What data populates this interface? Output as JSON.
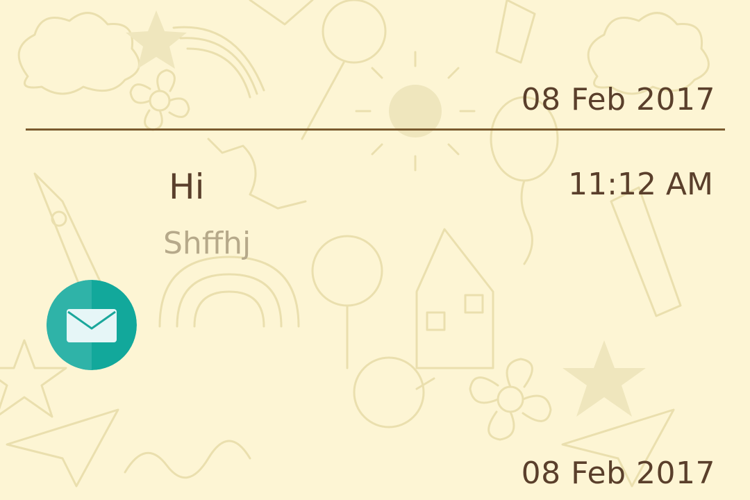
{
  "header_date_top": "08 Feb 2017",
  "header_date_bottom": "08 Feb 2017",
  "message": {
    "title": "Hi",
    "time": "11:12 AM",
    "preview": "Shffhj",
    "icon": "mail-icon"
  },
  "colors": {
    "background": "#fdf5d4",
    "text_primary": "#5a3f2b",
    "text_secondary": "#b6a98a",
    "divider": "#7a5a2e",
    "badge_teal": "#12a89b"
  }
}
